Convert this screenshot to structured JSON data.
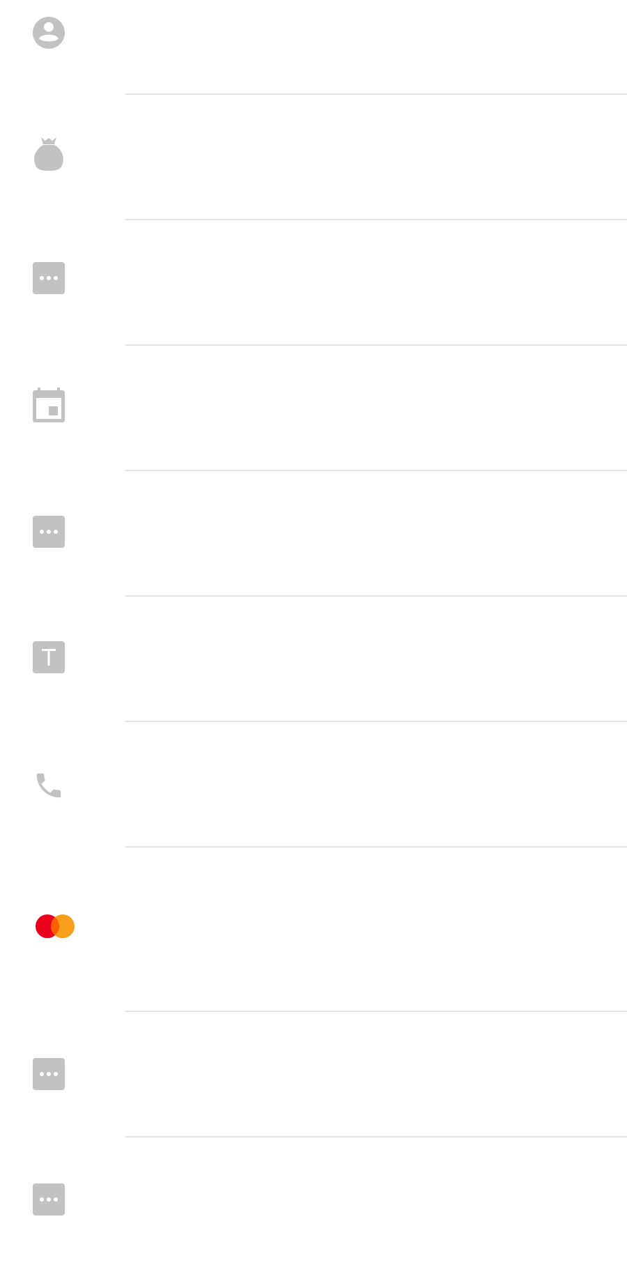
{
  "theme": {
    "icon_gray": "#c2c2c2",
    "divider": "#e4e4e4",
    "mastercard_red": "#eb001b",
    "mastercard_orange": "#f79e1b"
  },
  "rows": [
    {
      "icon": "account-circle-icon",
      "primary": "",
      "secondary": ""
    },
    {
      "icon": "money-bag-icon",
      "primary": "",
      "secondary": ""
    },
    {
      "icon": "more-box-icon",
      "primary": "",
      "secondary": ""
    },
    {
      "icon": "calendar-icon",
      "primary": "",
      "secondary": ""
    },
    {
      "icon": "more-box-icon",
      "primary": "",
      "secondary": ""
    },
    {
      "icon": "text-t-icon",
      "primary": "",
      "secondary": ""
    },
    {
      "icon": "phone-icon",
      "primary": "",
      "secondary": ""
    },
    {
      "icon": "mastercard-icon",
      "primary": "",
      "secondary": ""
    },
    {
      "icon": "more-box-icon",
      "primary": "",
      "secondary": ""
    },
    {
      "icon": "more-box-icon",
      "primary": "",
      "secondary": ""
    }
  ]
}
